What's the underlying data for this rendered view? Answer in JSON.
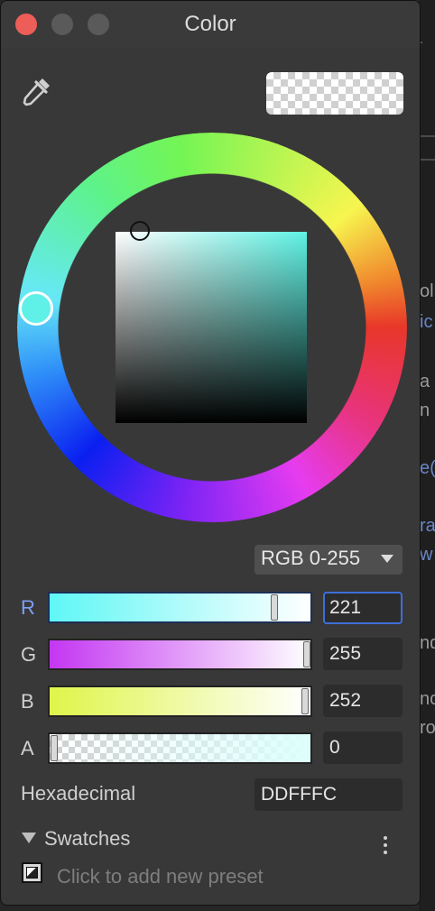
{
  "window": {
    "title": "Color"
  },
  "current_color_hex": "#DDFFFC",
  "mode_selector": {
    "selected": "RGB 0-255"
  },
  "channels": [
    {
      "label": "R",
      "value": "221",
      "gradient_from": "#5ff7f5",
      "gradient_to": "#ffffff"
    },
    {
      "label": "G",
      "value": "255",
      "gradient_from": "#c436f2",
      "gradient_to": "#ffffff"
    },
    {
      "label": "B",
      "value": "252",
      "gradient_from": "#dff54a",
      "gradient_to": "#ffffff"
    },
    {
      "label": "A",
      "value": "0",
      "gradient_from": "transparent",
      "gradient_to": "#ddfffc"
    }
  ],
  "hexadecimal": {
    "label": "Hexadecimal",
    "value": "DDFFFC"
  },
  "swatches": {
    "label": "Swatches",
    "add_hint": "Click to add new preset"
  },
  "icons": [
    "eyedropper-icon",
    "preset-swatch-icon",
    "more-options-icon",
    "disclosure-triangle-icon"
  ]
}
